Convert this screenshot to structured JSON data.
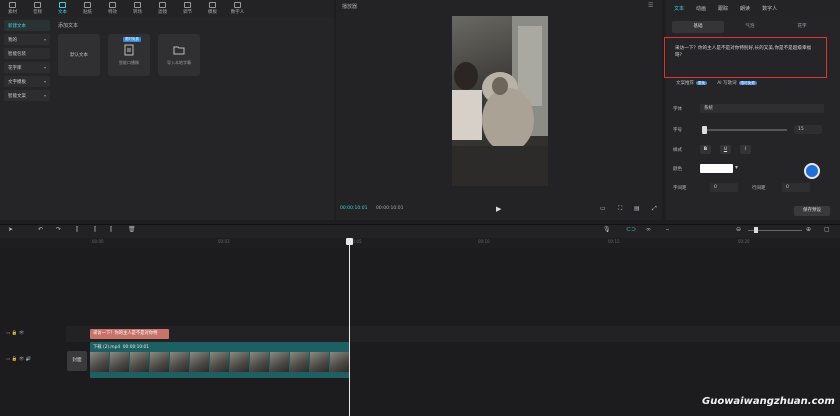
{
  "toolbar": {
    "items": [
      "素材",
      "音频",
      "文本",
      "贴纸",
      "特效",
      "转场",
      "滤镜",
      "调节",
      "模板",
      "数字人"
    ],
    "active_index": 2
  },
  "left_nav": {
    "items": [
      "新建文本",
      "我的",
      "智能包装",
      "花字库",
      "文字模板",
      "智能文案"
    ],
    "active_index": 0
  },
  "content": {
    "section_title": "添加文本",
    "cards": [
      {
        "title": "默认文本",
        "label": ""
      },
      {
        "title": "",
        "label": "智能口播稿",
        "badge": "限时免费"
      },
      {
        "title": "",
        "label": "导入本地字幕"
      }
    ]
  },
  "preview": {
    "title": "播放器",
    "current_time": "00:00:10:01",
    "total_time": "00:00:10:01"
  },
  "right_panel": {
    "tabs": [
      "文本",
      "动画",
      "跟踪",
      "朗读",
      "数字人"
    ],
    "active_tab": 0,
    "subtabs": [
      "基础",
      "气泡",
      "花字"
    ],
    "active_subtab": 0,
    "text_content": "采访一下？你的主人是不是对你特别好,长的又美,你是不是超级幸福呀?",
    "ai_tools": [
      {
        "label": "文案推荐",
        "badge": "限免"
      },
      {
        "label": "AI 写歌词",
        "badge": "限时免费"
      }
    ],
    "properties": {
      "font_label": "字体",
      "font_value": "系统",
      "size_label": "字号",
      "size_value": "15",
      "style_label": "样式",
      "style_buttons": [
        "B",
        "U",
        "I"
      ],
      "color_label": "颜色",
      "color_value": "#ffffff",
      "char_spacing_label": "字间距",
      "char_spacing_value": "0",
      "line_spacing_label": "行间距",
      "line_spacing_value": "0"
    },
    "save_button": "保存预设"
  },
  "timeline": {
    "ruler": [
      "00:00",
      "00:03",
      "00:05",
      "00:10",
      "00:15",
      "00:20"
    ],
    "text_clip": "采访一下？你的主人是不是对你特",
    "video_clip_name": "下载 (2).mp4",
    "video_clip_duration": "00:00:10:01",
    "cover_label": "封面"
  },
  "watermark": "Guowaiwangzhuan.com",
  "colors": {
    "accent": "#3fd0d8",
    "highlight_box": "#d33333",
    "text_clip": "#c8726a",
    "video_clip": "#1e5f63"
  }
}
